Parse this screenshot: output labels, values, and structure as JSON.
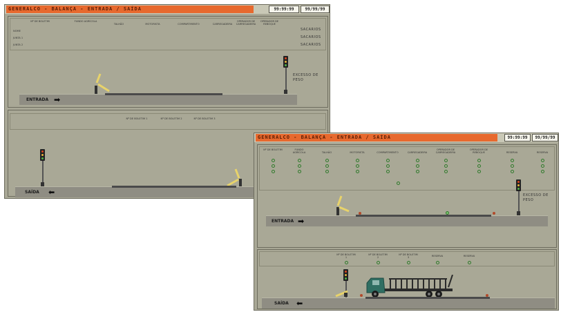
{
  "back_window": {
    "title": "GENERALCO - BALANÇA - ENTRADA / SAÍDA",
    "user": "USER",
    "time": "99:99:99",
    "date": "99/99/99",
    "columns": [
      "Nº DE BOLETIM",
      "FUNDO AGRÍCOLA",
      "TALHÃO",
      "MOTORISTA",
      "COMPARTIMENTO",
      "CARREGADEIRA",
      "OPERADOR DE CARREGADEIRA",
      "OPERADOR DE REBOQUE"
    ],
    "rows": [
      "NOME",
      "JUNTA 1",
      "JUNTA 2"
    ],
    "sacaria_label": "SACARIOS",
    "warning": "EXCESSO DE PESO",
    "entrada_label": "ENTRADA",
    "saida_columns": [
      "Nº DE BOLETIM 1",
      "Nº DE BOLETIM 2",
      "Nº DE BOLETIM 3"
    ],
    "saida_label": "SAÍDA"
  },
  "front_window": {
    "title": "GENERALCO - BALANÇA - ENTRADA / SAÍDA",
    "user": "USER",
    "time": "99:99:99",
    "date": "99/99/99",
    "columns": [
      "Nº DE BOLETIM",
      "FUNDO AGRÍCOLA",
      "TALHÃO",
      "MOTORISTA",
      "COMPARTIMENTO",
      "CARREGADEIRA",
      "OPERADOR DE CARREGADEIRA",
      "OPERADOR DE REBOQUE",
      "RESERVA",
      "RESERVA"
    ],
    "warning": "EXCESSO DE PESO",
    "entrada_label": "ENTRADA",
    "saida_columns": [
      "Nº DE BOLETIM 1",
      "Nº DE BOLETIM 2",
      "Nº DE BOLETIM 3",
      "RESERVA",
      "RESERVA"
    ],
    "saida_label": "SAÍDA"
  },
  "colors": {
    "titlebar_accent": "#e7692e",
    "panel_bg": "#a9a896",
    "track": "#8f8d83",
    "indicator": "#2e7a2a",
    "gate_arm": "#e8d36a",
    "truck_cab": "#2f6e62"
  },
  "icons": [
    "traffic-light-icon",
    "gate-barrier-icon",
    "arrow-right-icon",
    "arrow-left-icon",
    "truck-icon",
    "indicator-led-icon"
  ]
}
